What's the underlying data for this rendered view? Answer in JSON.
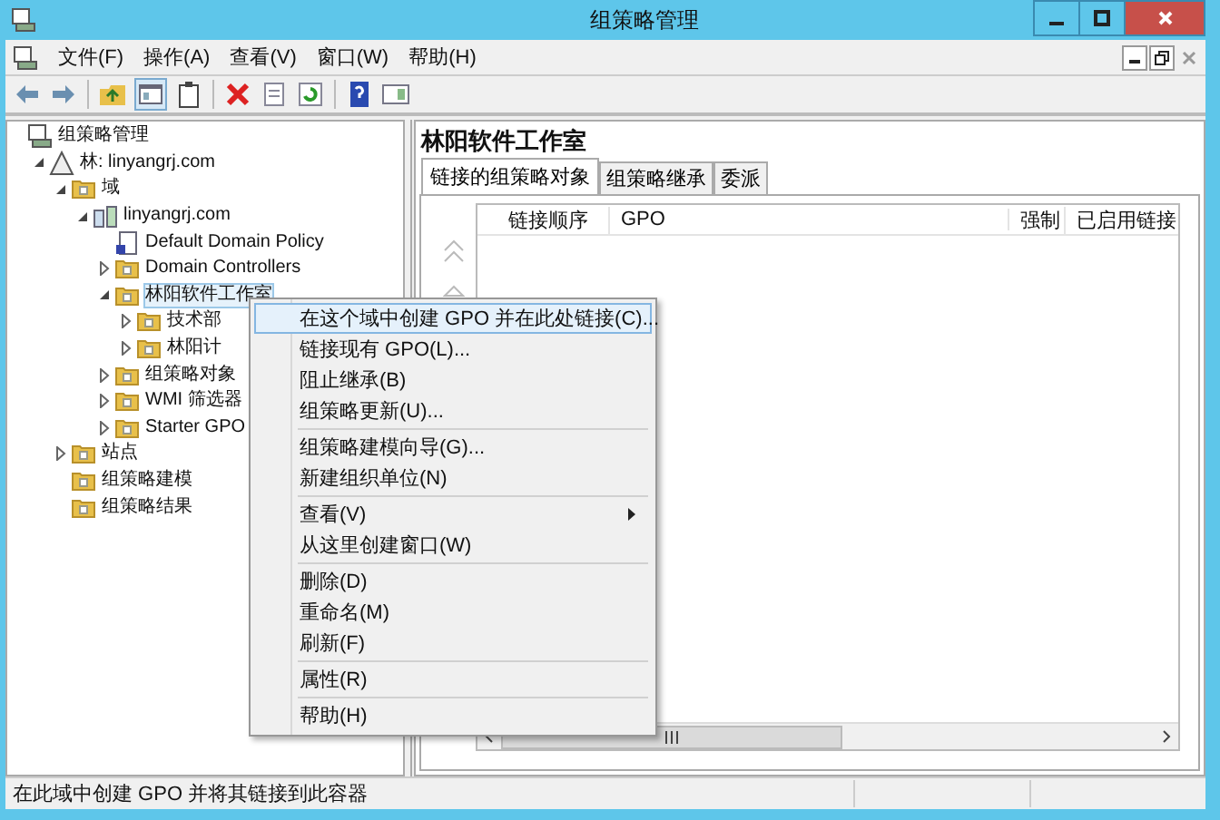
{
  "window": {
    "title": "组策略管理"
  },
  "menu_bar": [
    "文件(F)",
    "操作(A)",
    "查看(V)",
    "窗口(W)",
    "帮助(H)"
  ],
  "tree": [
    {
      "label": "组策略管理",
      "kind": "console",
      "selected": false,
      "children": [
        {
          "label": "林: linyangrj.com",
          "kind": "forest",
          "expanded": true,
          "selected": false,
          "children": [
            {
              "label": "域",
              "kind": "folder",
              "expanded": true,
              "selected": false,
              "children": [
                {
                  "label": "linyangrj.com",
                  "kind": "domain",
                  "expanded": true,
                  "selected": false,
                  "children": [
                    {
                      "label": "Default Domain Policy",
                      "kind": "policy",
                      "selected": false
                    },
                    {
                      "label": "Domain Controllers",
                      "kind": "folder",
                      "expanded": false,
                      "selected": false
                    },
                    {
                      "label": "林阳软件工作室",
                      "kind": "folder",
                      "expanded": true,
                      "selected": true,
                      "children": [
                        {
                          "label": "技术部",
                          "kind": "folder",
                          "expanded": false,
                          "selected": false
                        },
                        {
                          "label": "林阳计",
                          "kind": "folder",
                          "expanded": false,
                          "selected": false
                        }
                      ]
                    },
                    {
                      "label": "组策略对象",
                      "kind": "folder",
                      "expanded": false,
                      "selected": false
                    },
                    {
                      "label": "WMI 筛选器",
                      "kind": "folder",
                      "expanded": false,
                      "selected": false
                    },
                    {
                      "label": "Starter GPO",
                      "kind": "folder",
                      "expanded": false,
                      "selected": false
                    }
                  ]
                }
              ]
            },
            {
              "label": "站点",
              "kind": "folder",
              "expanded": false,
              "selected": false
            },
            {
              "label": "组策略建模",
              "kind": "folder",
              "selected": false
            },
            {
              "label": "组策略结果",
              "kind": "folder",
              "selected": false
            }
          ]
        }
      ]
    }
  ],
  "detail": {
    "title": "林阳软件工作室",
    "tabs": [
      {
        "label": "链接的组策略对象",
        "selected": true
      },
      {
        "label": "组策略继承",
        "selected": false
      },
      {
        "label": "委派",
        "selected": false
      }
    ],
    "columns": [
      "链接顺序",
      "GPO",
      "强制",
      "已启用链接"
    ]
  },
  "context_menu": [
    [
      {
        "label": "在这个域中创建 GPO 并在此处链接(C)...",
        "selected": true,
        "submenu": false
      },
      {
        "label": "链接现有 GPO(L)...",
        "selected": false,
        "submenu": false
      },
      {
        "label": "阻止继承(B)",
        "selected": false,
        "submenu": false
      },
      {
        "label": "组策略更新(U)...",
        "selected": false,
        "submenu": false
      }
    ],
    [
      {
        "label": "组策略建模向导(G)...",
        "selected": false,
        "submenu": false
      },
      {
        "label": "新建组织单位(N)",
        "selected": false,
        "submenu": false
      }
    ],
    [
      {
        "label": "查看(V)",
        "selected": false,
        "submenu": true
      },
      {
        "label": "从这里创建窗口(W)",
        "selected": false,
        "submenu": false
      }
    ],
    [
      {
        "label": "删除(D)",
        "selected": false,
        "submenu": false
      },
      {
        "label": "重命名(M)",
        "selected": false,
        "submenu": false
      },
      {
        "label": "刷新(F)",
        "selected": false,
        "submenu": false
      }
    ],
    [
      {
        "label": "属性(R)",
        "selected": false,
        "submenu": false
      }
    ],
    [
      {
        "label": "帮助(H)",
        "selected": false,
        "submenu": false
      }
    ]
  ],
  "status_bar": "在此域中创建 GPO 并将其链接到此容器"
}
